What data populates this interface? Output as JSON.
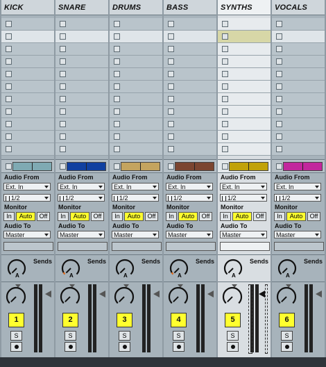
{
  "labels": {
    "audio_from": "Audio From",
    "monitor": "Monitor",
    "audio_to": "Audio To",
    "sends": "Sends",
    "solo": "S",
    "mon_in": "In",
    "mon_auto": "Auto",
    "mon_off": "Off"
  },
  "tracks": [
    {
      "name": "KICK",
      "color": "#7faab3",
      "input_type": "Ext. In",
      "input_channel": "1/2",
      "monitor": "Auto",
      "output": "Master",
      "number": "1"
    },
    {
      "name": "SNARE",
      "color": "#1040a0",
      "input_type": "Ext. In",
      "input_channel": "1/2",
      "monitor": "Auto",
      "output": "Master",
      "number": "2"
    },
    {
      "name": "DRUMS",
      "color": "#c4a45f",
      "input_type": "Ext. In",
      "input_channel": "1/2",
      "monitor": "Auto",
      "output": "Master",
      "number": "3"
    },
    {
      "name": "BASS",
      "color": "#7b4530",
      "input_type": "Ext. In",
      "input_channel": "1/2",
      "monitor": "Auto",
      "output": "Master",
      "number": "4"
    },
    {
      "name": "SYNTHS",
      "color": "#c1a20a",
      "input_type": "Ext. In",
      "input_channel": "1/2",
      "monitor": "Auto",
      "output": "Master",
      "number": "5"
    },
    {
      "name": "VOCALS",
      "color": "#c2289d",
      "input_type": "Ext. In",
      "input_channel": "1/2",
      "monitor": "Auto",
      "output": "Master",
      "number": "6"
    }
  ],
  "selected_track_index": 4
}
